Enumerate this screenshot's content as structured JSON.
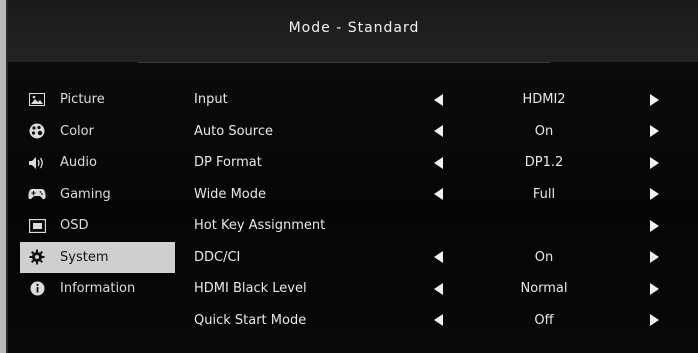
{
  "header": {
    "title": "Mode  -  Standard"
  },
  "sidebar": {
    "items": [
      {
        "label": "Picture",
        "icon": "picture-icon",
        "active": false
      },
      {
        "label": "Color",
        "icon": "palette-icon",
        "active": false
      },
      {
        "label": "Audio",
        "icon": "speaker-icon",
        "active": false
      },
      {
        "label": "Gaming",
        "icon": "gamepad-icon",
        "active": false
      },
      {
        "label": "OSD",
        "icon": "osd-icon",
        "active": false
      },
      {
        "label": "System",
        "icon": "gear-icon",
        "active": true
      },
      {
        "label": "Information",
        "icon": "info-icon",
        "active": false
      }
    ]
  },
  "options": {
    "rows": [
      {
        "label": "Input",
        "value": "HDMI2",
        "left_arrow": true,
        "right_arrow": true
      },
      {
        "label": "Auto Source",
        "value": "On",
        "left_arrow": true,
        "right_arrow": true
      },
      {
        "label": "DP Format",
        "value": "DP1.2",
        "left_arrow": true,
        "right_arrow": true
      },
      {
        "label": "Wide Mode",
        "value": "Full",
        "left_arrow": true,
        "right_arrow": true
      },
      {
        "label": "Hot Key Assignment",
        "value": "",
        "left_arrow": false,
        "right_arrow": true
      },
      {
        "label": "DDC/CI",
        "value": "On",
        "left_arrow": true,
        "right_arrow": true
      },
      {
        "label": "HDMI Black Level",
        "value": "Normal",
        "left_arrow": true,
        "right_arrow": true
      },
      {
        "label": "Quick Start Mode",
        "value": "Off",
        "left_arrow": true,
        "right_arrow": true
      }
    ]
  }
}
